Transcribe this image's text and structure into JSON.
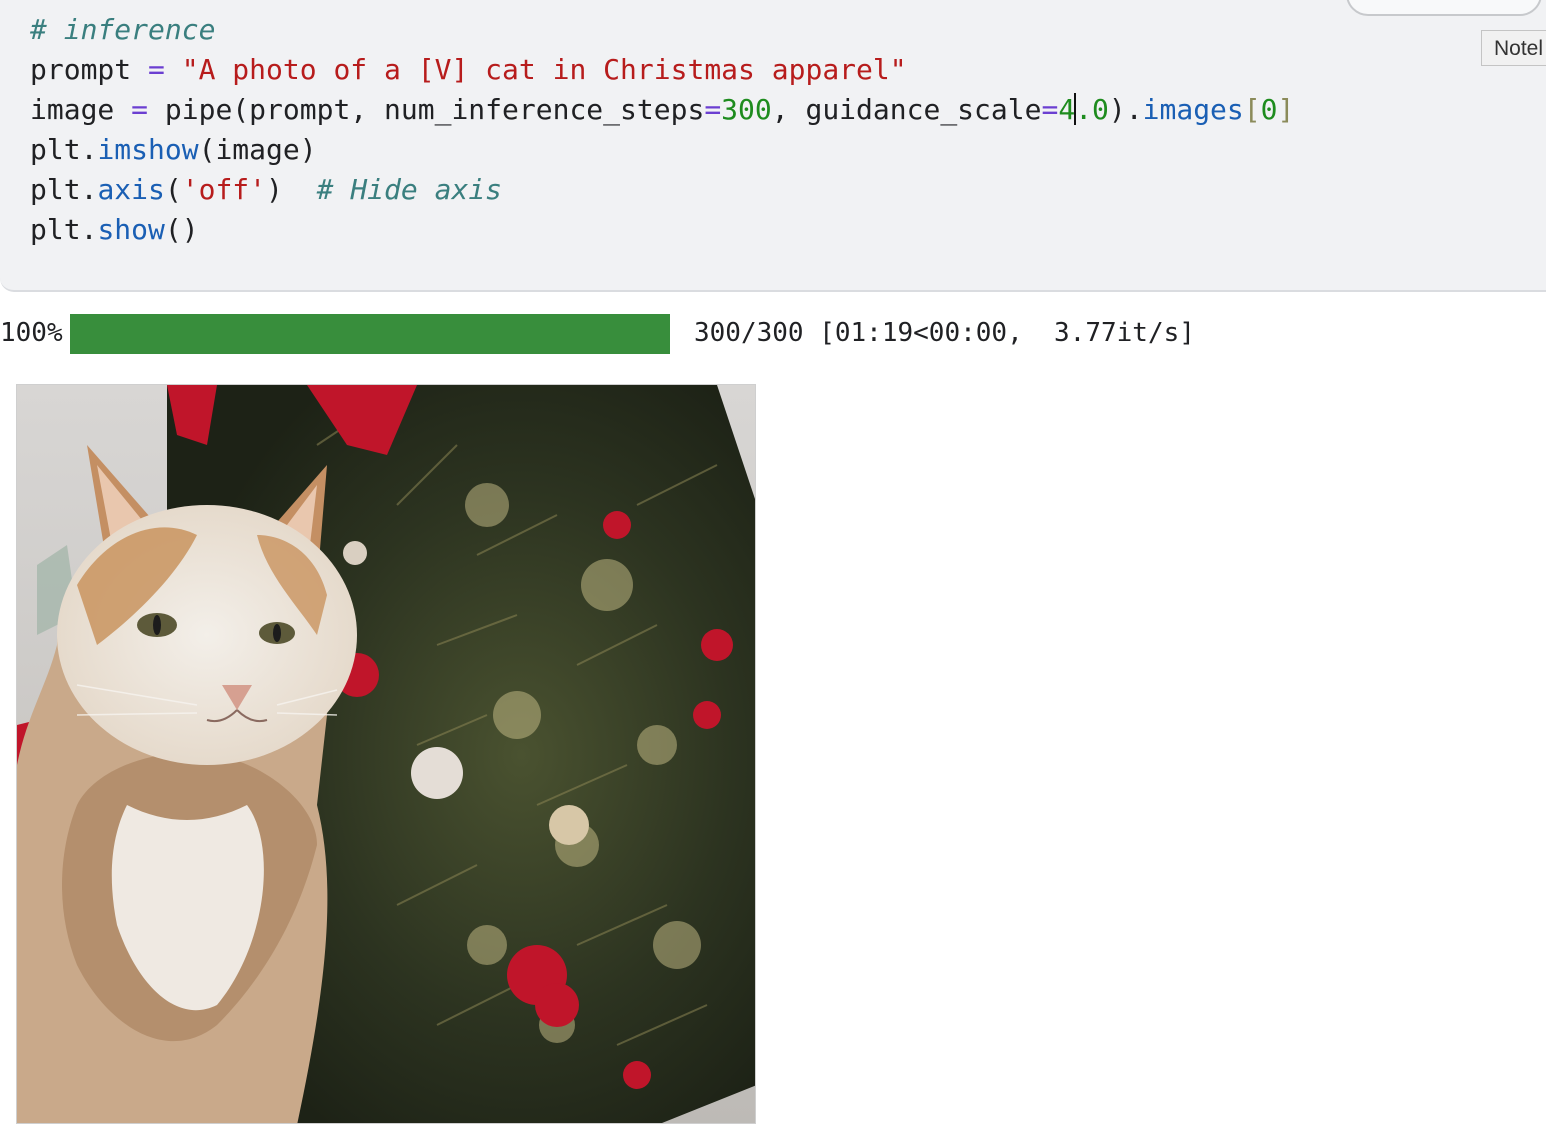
{
  "cell": {
    "lines": [
      [
        {
          "t": "# inference",
          "c": "comment"
        }
      ],
      [
        {
          "t": "prompt ",
          "c": ""
        },
        {
          "t": "=",
          "c": "kw"
        },
        {
          "t": " ",
          "c": ""
        },
        {
          "t": "\"A photo of a [V] cat in Christmas apparel\"",
          "c": "str"
        }
      ],
      [
        {
          "t": "image ",
          "c": ""
        },
        {
          "t": "=",
          "c": "kw"
        },
        {
          "t": " pipe(prompt, num_inference_steps",
          "c": ""
        },
        {
          "t": "=",
          "c": "kw"
        },
        {
          "t": "300",
          "c": "num"
        },
        {
          "t": ", guidance_scale",
          "c": ""
        },
        {
          "t": "=",
          "c": "kw"
        },
        {
          "t": "4",
          "c": "num"
        },
        {
          "t": "",
          "c": "cursor"
        },
        {
          "t": ".0",
          "c": "num"
        },
        {
          "t": ").",
          "c": ""
        },
        {
          "t": "images",
          "c": "fn"
        },
        {
          "t": "[",
          "c": "brk"
        },
        {
          "t": "0",
          "c": "num"
        },
        {
          "t": "]",
          "c": "brk"
        }
      ],
      [
        {
          "t": "plt.",
          "c": ""
        },
        {
          "t": "imshow",
          "c": "fn"
        },
        {
          "t": "(image)",
          "c": ""
        }
      ],
      [
        {
          "t": "plt.",
          "c": ""
        },
        {
          "t": "axis",
          "c": "fn"
        },
        {
          "t": "(",
          "c": ""
        },
        {
          "t": "'off'",
          "c": "str"
        },
        {
          "t": ")  ",
          "c": ""
        },
        {
          "t": "# Hide axis",
          "c": "comment"
        }
      ],
      [
        {
          "t": "plt.",
          "c": ""
        },
        {
          "t": "show",
          "c": "fn"
        },
        {
          "t": "()",
          "c": ""
        }
      ]
    ]
  },
  "tooltip": {
    "label": "Notel"
  },
  "progress": {
    "percent_label": "100%",
    "fraction": 1.0,
    "status": "300/300 [01:19<00:00,  3.77it/s]",
    "fill_color": "#388e3c"
  },
  "output": {
    "image_desc": "cat-christmas-tree-image"
  }
}
